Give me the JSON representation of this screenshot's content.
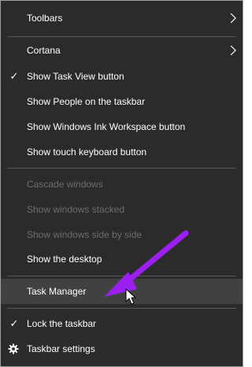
{
  "context_menu": {
    "items": [
      {
        "label": "Toolbars",
        "checked": false,
        "submenu": true,
        "enabled": true
      },
      {
        "label": "Cortana",
        "checked": false,
        "submenu": true,
        "enabled": true
      },
      {
        "label": "Show Task View button",
        "checked": true,
        "submenu": false,
        "enabled": true
      },
      {
        "label": "Show People on the taskbar",
        "checked": false,
        "submenu": false,
        "enabled": true
      },
      {
        "label": "Show Windows Ink Workspace button",
        "checked": false,
        "submenu": false,
        "enabled": true
      },
      {
        "label": "Show touch keyboard button",
        "checked": false,
        "submenu": false,
        "enabled": true
      },
      {
        "label": "Cascade windows",
        "checked": false,
        "submenu": false,
        "enabled": false
      },
      {
        "label": "Show windows stacked",
        "checked": false,
        "submenu": false,
        "enabled": false
      },
      {
        "label": "Show windows side by side",
        "checked": false,
        "submenu": false,
        "enabled": false
      },
      {
        "label": "Show the desktop",
        "checked": false,
        "submenu": false,
        "enabled": true
      },
      {
        "label": "Task Manager",
        "checked": false,
        "submenu": false,
        "enabled": true,
        "highlighted": true
      },
      {
        "label": "Lock the taskbar",
        "checked": true,
        "submenu": false,
        "enabled": true
      },
      {
        "label": "Taskbar settings",
        "checked": false,
        "submenu": false,
        "enabled": true,
        "icon": "gear-icon"
      }
    ],
    "checkmark_glyph": "✓",
    "colors": {
      "background": "#2b2b2b",
      "text": "#ffffff",
      "disabled_text": "#6d6d6d",
      "hover": "#414141",
      "separator": "#585858",
      "annotation_arrow": "#9b1ff2"
    }
  },
  "annotation": {
    "type": "arrow",
    "points_to": "Task Manager"
  }
}
